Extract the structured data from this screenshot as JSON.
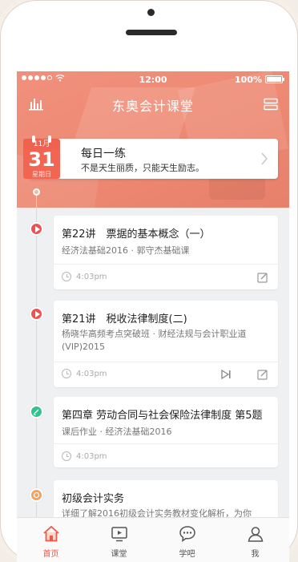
{
  "status_bar": {
    "time": "12:00",
    "battery": "100%"
  },
  "header": {
    "title": "东奥会计课堂",
    "chart_icon": "bar-chart-icon",
    "menu_icon": "menu-icon"
  },
  "calendar": {
    "month": "11月",
    "day": "31",
    "weekday": "星期日"
  },
  "daily": {
    "title": "每日一练",
    "subtitle": "不是天生丽质，只能天生励志。"
  },
  "items": [
    {
      "type": "video",
      "title": "第22讲　票据的基本概念（一）",
      "subtitle": "经济法基础2016 · 郭守杰基础课",
      "time": "4:03pm",
      "actions": [
        "edit"
      ]
    },
    {
      "type": "video",
      "title": "第21讲　税收法律制度(二)",
      "subtitle": "杨晓华高频考点突破班 · 财经法规与会计职业道(VIP)2015",
      "time": "4:03pm",
      "actions": [
        "play-next",
        "edit"
      ]
    },
    {
      "type": "homework",
      "title": "第四章 劳动合同与社会保险法律制度 第5题",
      "subtitle": "课后作业 · 经济法基础2016",
      "time": "4:03pm",
      "actions": []
    },
    {
      "type": "book",
      "title": "初级会计实务",
      "subtitle": "详细了解2016初级会计实务教材变化解析，为你",
      "time": "",
      "actions": []
    }
  ],
  "tabs": [
    {
      "label": "首页",
      "icon": "home-icon",
      "active": true
    },
    {
      "label": "课堂",
      "icon": "classroom-icon",
      "active": false
    },
    {
      "label": "学吧",
      "icon": "chat-icon",
      "active": false
    },
    {
      "label": "我",
      "icon": "user-icon",
      "active": false
    }
  ],
  "colors": {
    "accent": "#ee5a48",
    "header": "#ee8a74",
    "video": "#ee5253",
    "homework": "#32c28d",
    "book": "#f5a35c"
  }
}
